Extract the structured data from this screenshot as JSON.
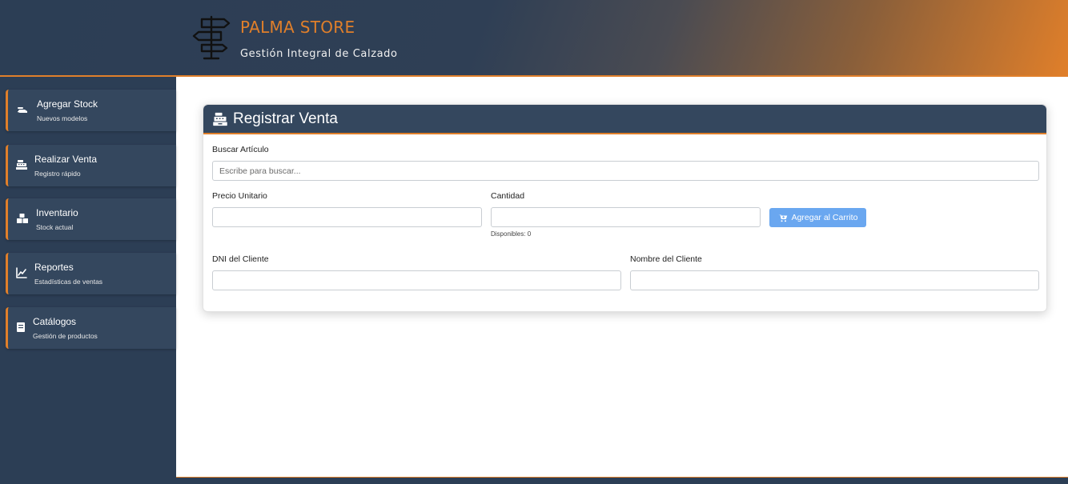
{
  "header": {
    "brand_title": "PALMA STORE",
    "brand_subtitle": "Gestión Integral de Calzado",
    "logo_icon": "signpost-icon"
  },
  "sidebar": {
    "items": [
      {
        "label": "Agregar Stock",
        "sub": "Nuevos modelos",
        "icon": "shoe-icon"
      },
      {
        "label": "Realizar Venta",
        "sub": "Registro rápido",
        "icon": "cash-register-icon"
      },
      {
        "label": "Inventario",
        "sub": "Stock actual",
        "icon": "boxes-icon"
      },
      {
        "label": "Reportes",
        "sub": "Estadísticas de ventas",
        "icon": "chart-line-icon"
      },
      {
        "label": "Catálogos",
        "sub": "Gestión de productos",
        "icon": "book-icon"
      }
    ]
  },
  "card": {
    "title": "Registrar Venta",
    "icon": "cash-register-icon",
    "search": {
      "label": "Buscar Artículo",
      "placeholder": "Escribe para buscar...",
      "value": ""
    },
    "price": {
      "label": "Precio Unitario",
      "value": ""
    },
    "quantity": {
      "label": "Cantidad",
      "value": "",
      "helper": "Disponibles: 0"
    },
    "add_cart_label": "Agregar al Carrito",
    "dni": {
      "label": "DNI del Cliente",
      "value": ""
    },
    "client_name": {
      "label": "Nombre del Cliente",
      "value": ""
    }
  },
  "colors": {
    "primary": "#2c3e55",
    "accent": "#e07f2a",
    "button": "#6aa7f0"
  }
}
